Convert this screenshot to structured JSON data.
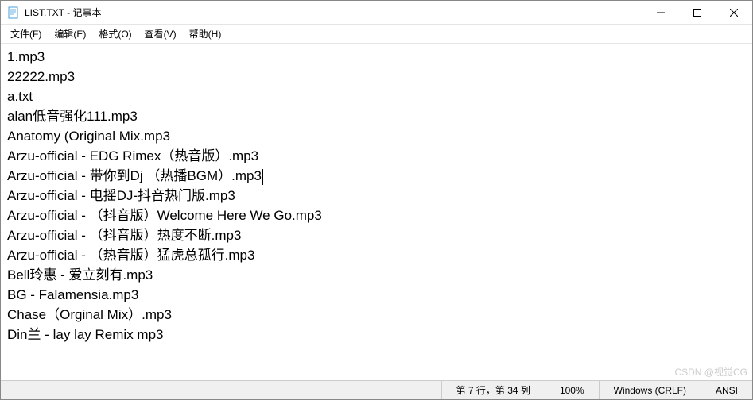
{
  "window": {
    "title": "LIST.TXT - 记事本"
  },
  "menu": {
    "file": "文件(F)",
    "edit": "编辑(E)",
    "format": "格式(O)",
    "view": "查看(V)",
    "help": "帮助(H)"
  },
  "content": {
    "lines": [
      "1.mp3",
      "22222.mp3",
      "a.txt",
      "alan低音强化111.mp3",
      "Anatomy (Original Mix.mp3",
      "Arzu-official - EDG Rimex（热音版）.mp3",
      "Arzu-official - 带你到Dj （热播BGM）.mp3",
      "Arzu-official - 电摇DJ-抖音热门版.mp3",
      "Arzu-official - （抖音版）Welcome Here We Go.mp3",
      "Arzu-official - （抖音版）热度不断.mp3",
      "Arzu-official - （热音版）猛虎总孤行.mp3",
      "Bell玲惠 - 爱立刻有.mp3",
      "BG - Falamensia.mp3",
      "Chase（Orginal Mix）.mp3",
      "Din兰 - lay lay Remix mp3"
    ],
    "cursor_line_index": 6
  },
  "statusbar": {
    "position": "第 7 行，第 34 列",
    "zoom": "100%",
    "line_ending": "Windows (CRLF)",
    "encoding": "ANSI"
  },
  "watermark": "CSDN @视觉CG"
}
